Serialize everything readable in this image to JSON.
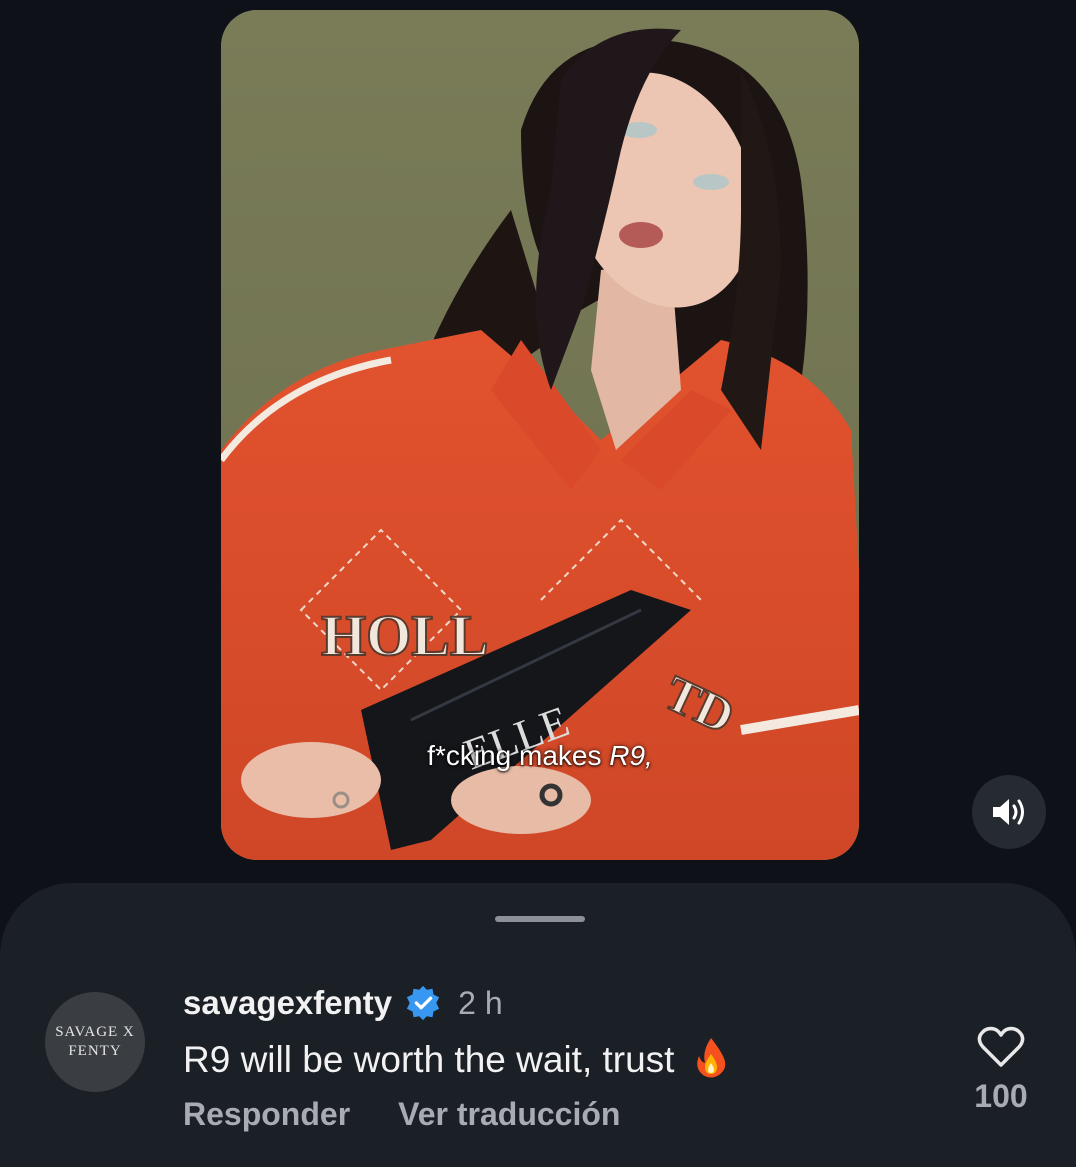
{
  "video": {
    "caption_prefix": "f*cking makes",
    "caption_suffix": "R9,",
    "mute_icon": "speaker-icon"
  },
  "comment": {
    "avatar_line1": "SAVAGE X",
    "avatar_line2": "FENTY",
    "username": "savagexfenty",
    "verified_icon": "verified-badge-icon",
    "time": "2 h",
    "text": "R9 will be worth the wait, trust",
    "emoji": "fire-emoji",
    "reply_label": "Responder",
    "translate_label": "Ver traducción",
    "like_count": "100",
    "like_icon": "heart-icon"
  },
  "colors": {
    "background": "#0e1117",
    "sheet": "#1b1f26",
    "verified_blue": "#3897f0",
    "muted_text": "#a8abb3"
  }
}
